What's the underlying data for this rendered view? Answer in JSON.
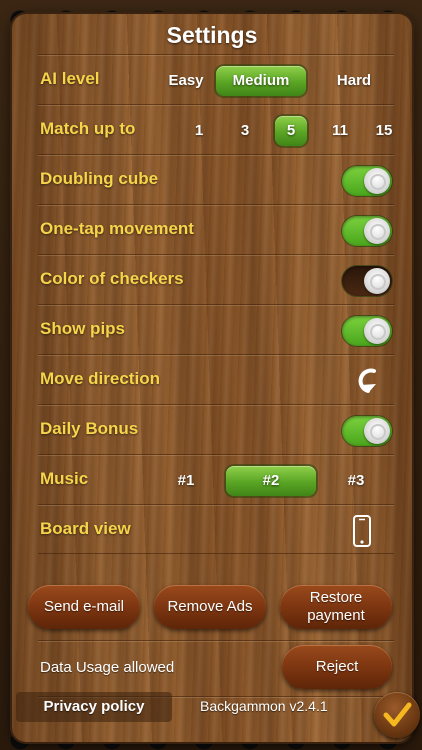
{
  "title": "Settings",
  "colors": {
    "label": "#f6d54a",
    "active_segment": "#5aa424",
    "button": "#7a3410",
    "checkmark": "#f5b821"
  },
  "ai_level": {
    "label": "AI level",
    "options": [
      "Easy",
      "Medium",
      "Hard"
    ],
    "selected": "Medium"
  },
  "match": {
    "label": "Match up to",
    "options": [
      "1",
      "3",
      "5",
      "11",
      "15"
    ],
    "selected": "5"
  },
  "doubling_cube": {
    "label": "Doubling cube",
    "on": true
  },
  "one_tap": {
    "label": "One-tap movement",
    "on": true
  },
  "checker_color": {
    "label": "Color of checkers",
    "on": false
  },
  "show_pips": {
    "label": "Show pips",
    "on": true
  },
  "move_direction": {
    "label": "Move direction",
    "icon": "rotate-arrow-icon"
  },
  "daily_bonus": {
    "label": "Daily Bonus",
    "on": true
  },
  "music": {
    "label": "Music",
    "options": [
      "#1",
      "#2",
      "#3"
    ],
    "selected": "#2"
  },
  "board_view": {
    "label": "Board view",
    "icon": "phone-portrait-icon"
  },
  "buttons": {
    "send_email": "Send e-mail",
    "remove_ads": "Remove Ads",
    "restore_line1": "Restore",
    "restore_line2": "payment",
    "reject": "Reject"
  },
  "data_usage": "Data Usage allowed",
  "privacy_policy": "Privacy policy",
  "version": "Backgammon v2.4.1",
  "confirm_icon": "checkmark-icon"
}
